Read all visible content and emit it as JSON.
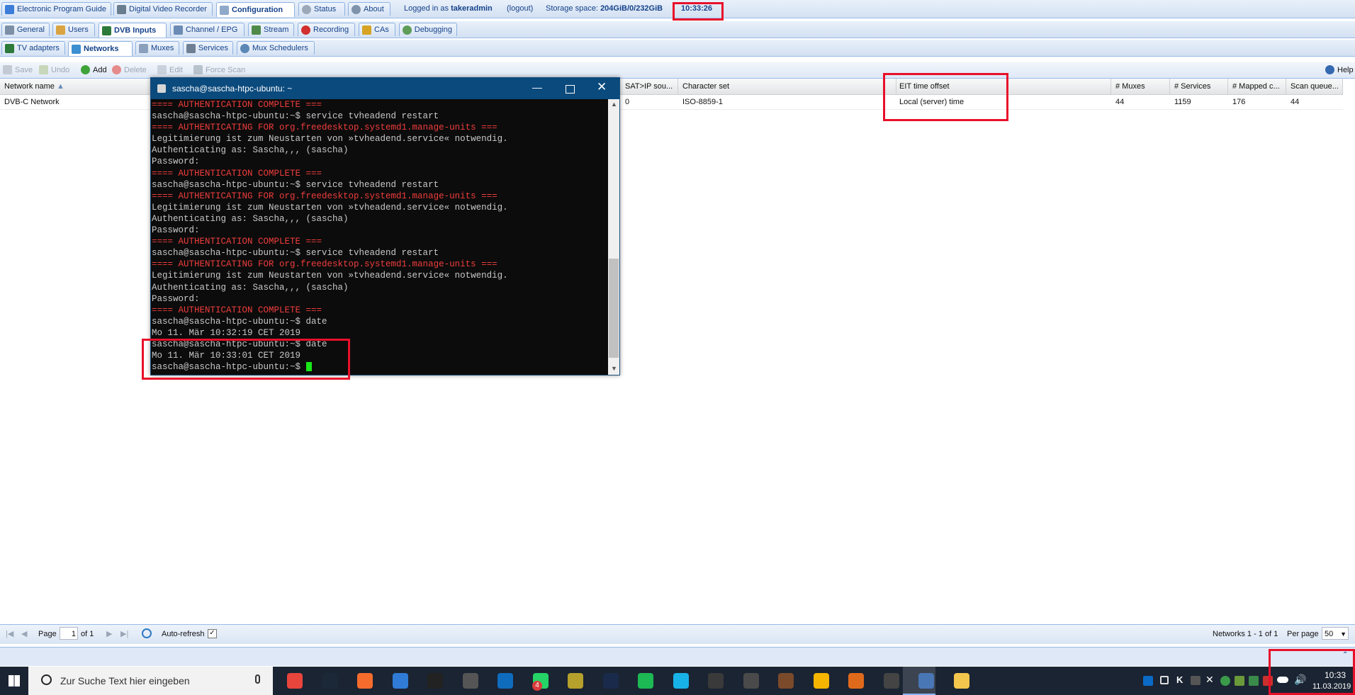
{
  "tabs_top": [
    {
      "label": "Electronic Program Guide"
    },
    {
      "label": "Digital Video Recorder"
    },
    {
      "label": "Configuration"
    },
    {
      "label": "Status"
    },
    {
      "label": "About"
    }
  ],
  "header": {
    "logged_in_prefix": "Logged in as",
    "user": "takeradmin",
    "logout": "(logout)",
    "storage_prefix": "Storage space:",
    "storage": "204GiB/0/232GiB",
    "clock": "10:33:26"
  },
  "tabs_config": [
    {
      "label": "General"
    },
    {
      "label": "Users"
    },
    {
      "label": "DVB Inputs"
    },
    {
      "label": "Channel / EPG"
    },
    {
      "label": "Stream"
    },
    {
      "label": "Recording"
    },
    {
      "label": "CAs"
    },
    {
      "label": "Debugging"
    }
  ],
  "tabs_dvb": [
    {
      "label": "TV adapters"
    },
    {
      "label": "Networks"
    },
    {
      "label": "Muxes"
    },
    {
      "label": "Services"
    },
    {
      "label": "Mux Schedulers"
    }
  ],
  "toolbar": {
    "save": "Save",
    "undo": "Undo",
    "add": "Add",
    "delete": "Delete",
    "edit": "Edit",
    "force_scan": "Force Scan",
    "help": "Help"
  },
  "grid": {
    "headers": {
      "network_name": "Network name",
      "sat_ip": "SAT>IP sou...",
      "charset": "Character set",
      "eit": "EIT time offset",
      "muxes": "# Muxes",
      "services": "# Services",
      "mapped": "# Mapped c...",
      "scanq": "Scan queue..."
    },
    "row": {
      "network_name": "DVB-C Network",
      "sat_ip": "0",
      "charset": "ISO-8859-1",
      "eit": "Local (server) time",
      "muxes": "44",
      "services": "1159",
      "mapped": "176",
      "scanq": "44"
    }
  },
  "terminal": {
    "title": "sascha@sascha-htpc-ubuntu: ~",
    "lines": [
      {
        "text": "==== AUTHENTICATION COMPLETE ===",
        "color": "red"
      },
      {
        "text": "sascha@sascha-htpc-ubuntu:~$ service tvheadend restart",
        "color": "white"
      },
      {
        "text": "==== AUTHENTICATING FOR org.freedesktop.systemd1.manage-units ===",
        "color": "red"
      },
      {
        "text": "Legitimierung ist zum Neustarten von »tvheadend.service« notwendig.",
        "color": "white"
      },
      {
        "text": "Authenticating as: Sascha,,, (sascha)",
        "color": "white"
      },
      {
        "text": "Password:",
        "color": "white"
      },
      {
        "text": "==== AUTHENTICATION COMPLETE ===",
        "color": "red"
      },
      {
        "text": "sascha@sascha-htpc-ubuntu:~$ service tvheadend restart",
        "color": "white"
      },
      {
        "text": "==== AUTHENTICATING FOR org.freedesktop.systemd1.manage-units ===",
        "color": "red"
      },
      {
        "text": "Legitimierung ist zum Neustarten von »tvheadend.service« notwendig.",
        "color": "white"
      },
      {
        "text": "Authenticating as: Sascha,,, (sascha)",
        "color": "white"
      },
      {
        "text": "Password:",
        "color": "white"
      },
      {
        "text": "==== AUTHENTICATION COMPLETE ===",
        "color": "red"
      },
      {
        "text": "sascha@sascha-htpc-ubuntu:~$ service tvheadend restart",
        "color": "white"
      },
      {
        "text": "==== AUTHENTICATING FOR org.freedesktop.systemd1.manage-units ===",
        "color": "red"
      },
      {
        "text": "Legitimierung ist zum Neustarten von »tvheadend.service« notwendig.",
        "color": "white"
      },
      {
        "text": "Authenticating as: Sascha,,, (sascha)",
        "color": "white"
      },
      {
        "text": "Password:",
        "color": "white"
      },
      {
        "text": "==== AUTHENTICATION COMPLETE ===",
        "color": "red"
      },
      {
        "text": "sascha@sascha-htpc-ubuntu:~$ date",
        "color": "white"
      },
      {
        "text": "Mo 11. Mär 10:32:19 CET 2019",
        "color": "white"
      },
      {
        "text": "sascha@sascha-htpc-ubuntu:~$ date",
        "color": "white"
      },
      {
        "text": "Mo 11. Mär 10:33:01 CET 2019",
        "color": "white"
      },
      {
        "text": "sascha@sascha-htpc-ubuntu:~$ ",
        "color": "white",
        "cursor": true
      }
    ]
  },
  "paging": {
    "page_label": "Page",
    "page_value": "1",
    "of_label": "of 1",
    "auto_refresh": "Auto-refresh",
    "summary": "Networks 1 - 1 of 1",
    "per_page_label": "Per page",
    "per_page_value": "50"
  },
  "taskbar": {
    "search_placeholder": "Zur Suche Text hier eingeben",
    "whatsapp_badge": "4",
    "time": "10:33",
    "date": "11.03.2019",
    "icons": [
      "chrome-icon",
      "steam-icon",
      "origin-icon",
      "uplay-icon",
      "m-app-icon",
      "headset-icon",
      "outlook-icon",
      "whatsapp-icon",
      "tool-icon",
      "amazon-music-icon",
      "spotify-icon",
      "kodi-icon",
      "film-icon",
      "fb-icon",
      "deer-icon",
      "explorer-icon",
      "vlc-icon",
      "pc-icon",
      "putty-icon",
      "folder-icon"
    ]
  },
  "colors": {
    "highlight": "#e8102a",
    "term_bg": "#0c0c0c",
    "term_red": "#f03c3c",
    "accent": "#15428b"
  }
}
